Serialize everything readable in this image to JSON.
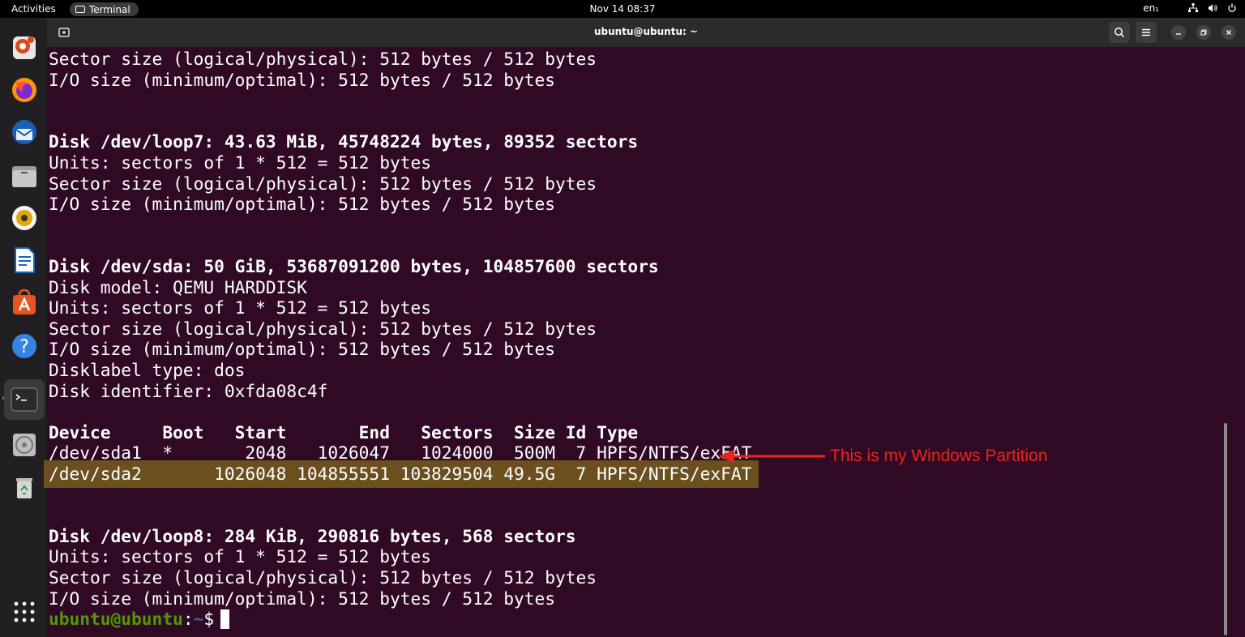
{
  "topbar": {
    "activities": "Activities",
    "app_name": "Terminal",
    "clock": "Nov 14  08:37",
    "language": "en₁"
  },
  "window": {
    "title": "ubuntu@ubuntu: ~"
  },
  "terminal": {
    "lines": [
      "Sector size (logical/physical): 512 bytes / 512 bytes",
      "I/O size (minimum/optimal): 512 bytes / 512 bytes",
      "",
      "",
      "Disk /dev/loop7: 43.63 MiB, 45748224 bytes, 89352 sectors",
      "Units: sectors of 1 * 512 = 512 bytes",
      "Sector size (logical/physical): 512 bytes / 512 bytes",
      "I/O size (minimum/optimal): 512 bytes / 512 bytes",
      "",
      "",
      "Disk /dev/sda: 50 GiB, 53687091200 bytes, 104857600 sectors",
      "Disk model: QEMU HARDDISK",
      "Units: sectors of 1 * 512 = 512 bytes",
      "Sector size (logical/physical): 512 bytes / 512 bytes",
      "I/O size (minimum/optimal): 512 bytes / 512 bytes",
      "Disklabel type: dos",
      "Disk identifier: 0xfda08c4f",
      "",
      "Device     Boot   Start       End   Sectors  Size Id Type",
      "/dev/sda1  *       2048   1026047   1024000  500M  7 HPFS/NTFS/exFAT",
      "/dev/sda2       1026048 104855551 103829504 49.5G  7 HPFS/NTFS/exFAT",
      "",
      "",
      "Disk /dev/loop8: 284 KiB, 290816 bytes, 568 sectors",
      "Units: sectors of 1 * 512 = 512 bytes",
      "Sector size (logical/physical): 512 bytes / 512 bytes",
      "I/O size (minimum/optimal): 512 bytes / 512 bytes"
    ],
    "prompt_user": "ubuntu@ubuntu",
    "prompt_sep": ":",
    "prompt_path": "~",
    "prompt_symbol": "$"
  },
  "annotation": {
    "text": "This is my Windows Partition",
    "color": "#e8241f"
  },
  "colors": {
    "terminal_bg": "#300a24",
    "highlight": "#6b4f1f",
    "prompt_user": "#4e9a06",
    "prompt_path": "#3465a4",
    "ubuntu_orange": "#e95420"
  },
  "dock": {
    "icons": [
      "ubuntu-installer-icon",
      "firefox-icon",
      "thunderbird-icon",
      "files-icon",
      "rhythmbox-icon",
      "libreoffice-writer-icon",
      "app-center-icon",
      "help-icon",
      "terminal-icon",
      "disc-icon",
      "trash-icon",
      "show-apps-icon"
    ]
  }
}
